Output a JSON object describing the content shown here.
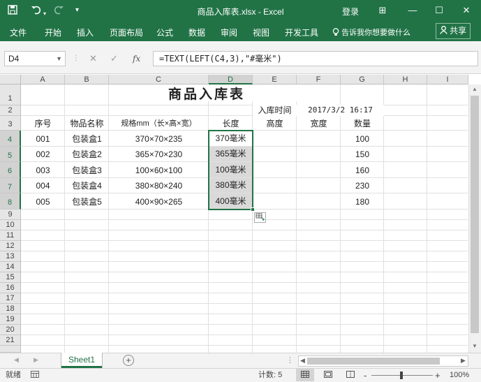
{
  "window": {
    "title": "商品入库表.xlsx  -  Excel",
    "login": "登录",
    "controls": {
      "ribbon_opts": "⊞",
      "minimize": "—",
      "maximize": "☐",
      "close": "✕"
    }
  },
  "quick_access": {
    "save_icon": "save-icon",
    "undo_icon": "undo-icon",
    "redo_icon": "redo-icon",
    "more": "₹"
  },
  "ribbon": {
    "tabs": [
      "文件",
      "开始",
      "插入",
      "页面布局",
      "公式",
      "数据",
      "审阅",
      "视图",
      "开发工具"
    ],
    "tell_me": "告诉我你想要做什么",
    "share": "共享"
  },
  "formula_bar": {
    "name_box": "D4",
    "cancel": "✕",
    "enter": "✓",
    "fx": "fx",
    "formula": "=TEXT(LEFT(C4,3),\"#毫米\")"
  },
  "sheet": {
    "columns": [
      "A",
      "B",
      "C",
      "D",
      "E",
      "F",
      "G",
      "H",
      "I"
    ],
    "selected_column": "D",
    "rows": [
      "1",
      "2",
      "3",
      "4",
      "5",
      "6",
      "7",
      "8",
      "9",
      "10",
      "11",
      "12",
      "13",
      "14",
      "15",
      "16",
      "17",
      "18",
      "19",
      "20",
      "21"
    ],
    "title": "商品入库表",
    "time_label": "入库时间",
    "time_value": "2017/3/2  16:17",
    "headers": [
      "序号",
      "物品名称",
      "规格mm（长×高×宽）",
      "长度",
      "高度",
      "宽度",
      "数量"
    ],
    "data_rows": [
      [
        "001",
        "包装盒1",
        "370×70×235",
        "370毫米",
        "",
        "",
        "100"
      ],
      [
        "002",
        "包装盒2",
        "365×70×230",
        "365毫米",
        "",
        "",
        "150"
      ],
      [
        "003",
        "包装盒3",
        "100×60×100",
        "100毫米",
        "",
        "",
        "160"
      ],
      [
        "004",
        "包装盒4",
        "380×80×240",
        "380毫米",
        "",
        "",
        "230"
      ],
      [
        "005",
        "包装盒5",
        "400×90×265",
        "400毫米",
        "",
        "",
        "180"
      ]
    ]
  },
  "sheet_tabs": {
    "active": "Sheet1",
    "add": "+"
  },
  "status": {
    "ready": "就绪",
    "count": "计数: 5",
    "zoom": "100%",
    "zoom_minus": "-",
    "zoom_plus": "+"
  }
}
